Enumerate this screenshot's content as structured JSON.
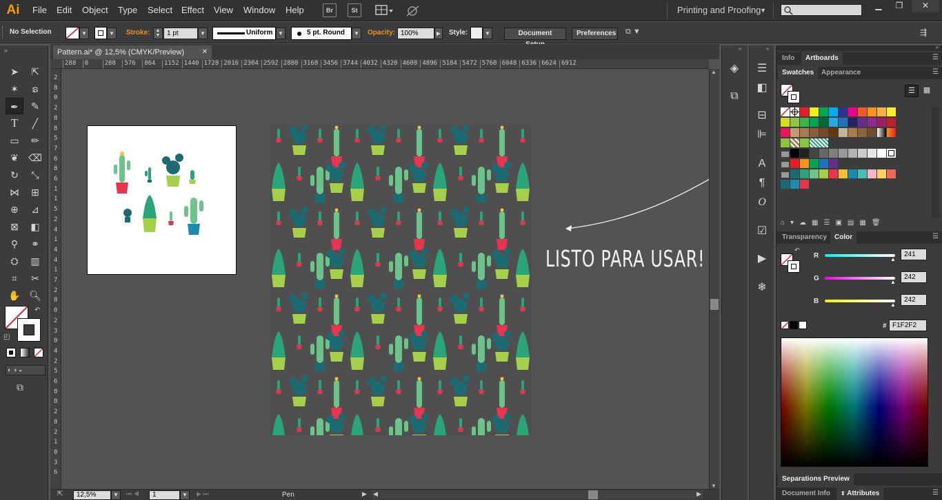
{
  "app": {
    "logo": "Ai"
  },
  "menu": [
    "File",
    "Edit",
    "Object",
    "Type",
    "Select",
    "Effect",
    "View",
    "Window",
    "Help"
  ],
  "menubar_buttons": {
    "bridge": "Br",
    "stock": "St"
  },
  "workspace": "Printing and Proofing",
  "control": {
    "selection": "No Selection",
    "stroke_label": "Stroke:",
    "stroke_weight": "1 pt",
    "profile": "Uniform",
    "brush": "5 pt. Round",
    "opacity_label": "Opacity:",
    "opacity": "100%",
    "style_label": "Style:",
    "doc_setup": "Document Setup",
    "preferences": "Preferences"
  },
  "document": {
    "tab_title": "Pattern.ai* @ 12,5% (CMYK/Preview)",
    "annotation": "LISTO PARA USAR!",
    "ruler_h": [
      "288",
      "0",
      "288",
      "576",
      "864",
      "1152",
      "1440",
      "1728",
      "2016",
      "2304",
      "2592",
      "2880",
      "3168",
      "3456",
      "3744",
      "4032",
      "4320",
      "4608",
      "4896",
      "5184",
      "5472",
      "5760",
      "6048",
      "6336",
      "6624",
      "6912"
    ],
    "ruler_v": [
      "2",
      "8",
      "0",
      "2",
      "8",
      "8",
      "5",
      "7",
      "6",
      "8",
      "6",
      "1",
      "1",
      "5",
      "2",
      "4",
      "1",
      "4",
      "4",
      "1",
      "7",
      "2",
      "8",
      "0",
      "2",
      "3",
      "0",
      "4",
      "2",
      "5",
      "6",
      "8",
      "8",
      "2",
      "8",
      "2",
      "1",
      "0",
      "3",
      "6"
    ]
  },
  "statusbar": {
    "zoom": "12,5%",
    "artboard": "1",
    "tool": "Pen"
  },
  "panels": {
    "top_tabs": [
      "Info",
      "Artboards"
    ],
    "active_top_tab": "Artboards",
    "swatch_tabs": [
      "Swatches",
      "Appearance"
    ],
    "color_tabs": [
      "Transparency",
      "Color"
    ],
    "color": {
      "r_label": "R",
      "g_label": "G",
      "b_label": "B",
      "r": "241",
      "g": "242",
      "b": "242",
      "hash": "#",
      "hex": "F1F2F2"
    },
    "separations": "Separations Preview",
    "bottom_tabs": [
      "Document Info",
      "Attributes"
    ]
  },
  "colors": {
    "accent_orange": "#ff9a00",
    "cactus_green": "#2aa57a",
    "cactus_teal": "#1c6b72",
    "pot_red": "#e8344e",
    "pot_lime": "#a6d04a"
  }
}
